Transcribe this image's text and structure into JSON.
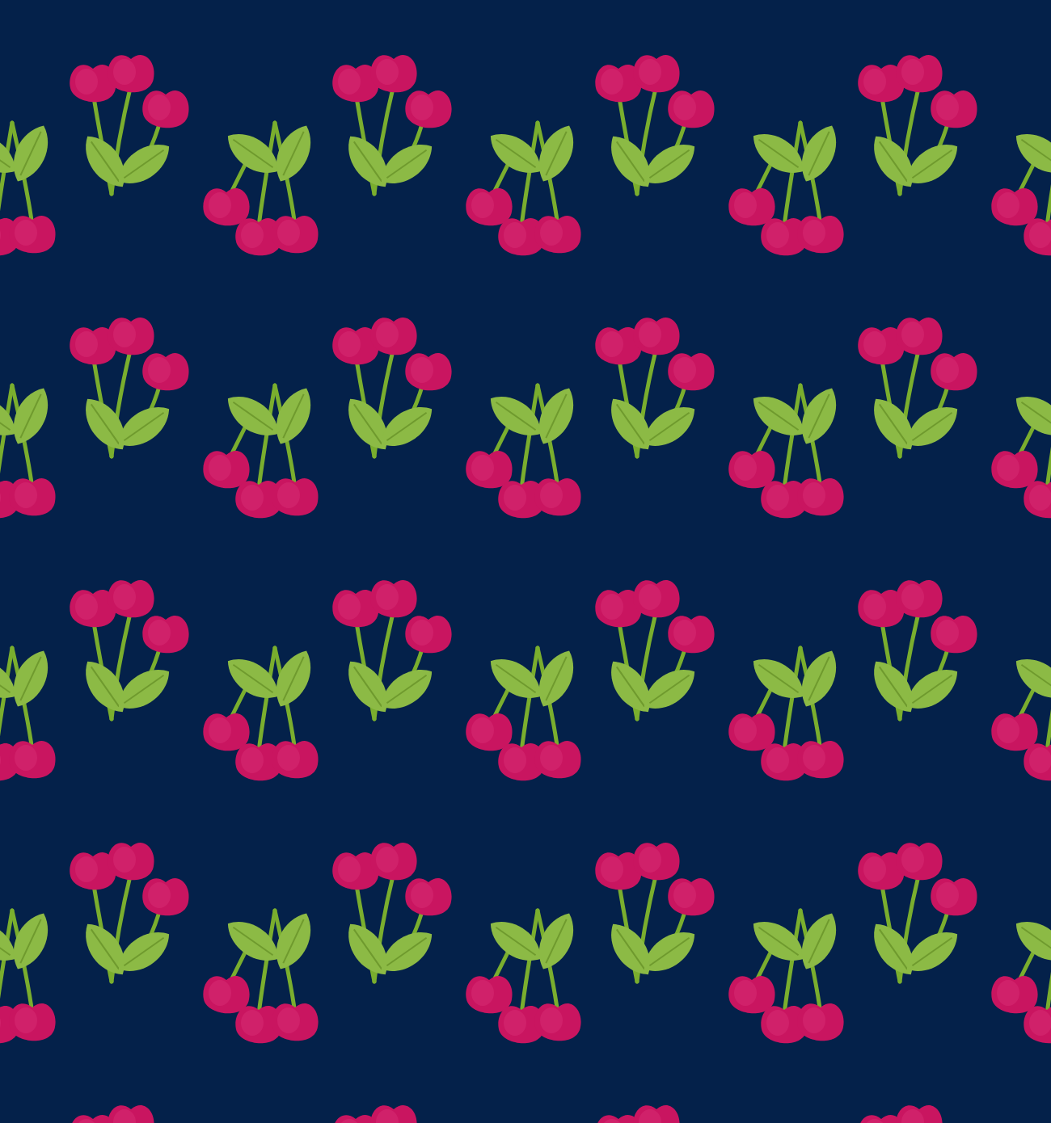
{
  "pattern": {
    "kind": "cherries"
  }
}
